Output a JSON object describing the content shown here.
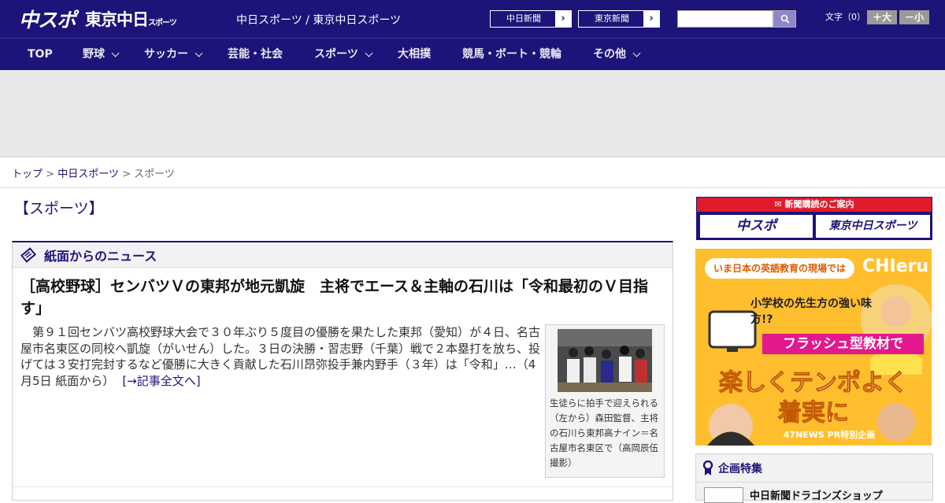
{
  "header": {
    "logo_primary": "中スポ",
    "logo_secondary": "東京中日",
    "logo_secondary_small": "スポーツ",
    "site_links": "中日スポーツ / 東京中日スポーツ",
    "paper_buttons": [
      {
        "label": "中日新聞"
      },
      {
        "label": "東京新聞"
      }
    ],
    "search": {
      "value": ""
    },
    "font_size_label": "文字（0）",
    "font_larger_label": "＋大",
    "font_smaller_label": "－小"
  },
  "nav": {
    "items": [
      {
        "label": "TOP",
        "has_dropdown": false
      },
      {
        "label": "野球",
        "has_dropdown": true
      },
      {
        "label": "サッカー",
        "has_dropdown": true
      },
      {
        "label": "芸能・社会",
        "has_dropdown": false
      },
      {
        "label": "スポーツ",
        "has_dropdown": true
      },
      {
        "label": "大相撲",
        "has_dropdown": false
      },
      {
        "label": "競馬・ボート・競輪",
        "has_dropdown": false
      },
      {
        "label": "その他",
        "has_dropdown": true
      }
    ]
  },
  "breadcrumb": {
    "items": [
      {
        "label": "トップ",
        "link": true
      },
      {
        "label": "中日スポーツ",
        "link": true
      },
      {
        "label": "スポーツ",
        "link": false
      }
    ],
    "separator": ">"
  },
  "section": {
    "title": "【スポーツ】"
  },
  "news_box": {
    "header": "紙面からのニュース",
    "headline": "［高校野球］センバツＶの東邦が地元凱旋　主将でエース＆主軸の石川は「令和最初のＶ目指す」",
    "body": "　第９１回センバツ高校野球大会で３０年ぶり５度目の優勝を果たした東邦（愛知）が４日、名古屋市名東区の同校へ凱旋（がいせん）した。３日の決勝・習志野（千葉）戦で２本塁打を放ち、投げては３安打完封するなど優勝に大きく貢献した石川昂弥投手兼内野手（３年）は「令和」…（4月5日 紙面から）",
    "more_link": "[→記事全文へ]",
    "photo_caption": "生徒らに拍手で迎えられる（左から）森田監督、主将の石川ら東邦高ナイン＝名古屋市名東区で（高岡辰伍撮影）"
  },
  "sidebar": {
    "subscribe_header": "新聞購読のご案内",
    "subscribe_buttons": [
      {
        "label": "中スポ"
      },
      {
        "label": "東京中日スポーツ"
      }
    ],
    "ad": {
      "tag": "いま日本の英語教育の現場では",
      "brand": "CHIeru",
      "lead": "小学校の先生方の強い味方!?",
      "highlight": "フラッシュ型教材で",
      "headline1": "楽しくテンポよく",
      "headline2": "着実に",
      "footer": "47NEWS PR特別企画"
    },
    "feature": {
      "header": "企画特集",
      "item": "中日新聞ドラゴンズショップ"
    }
  },
  "colors": {
    "brand_navy": "#1c1478",
    "subscribe_red": "#e01b2b",
    "ad_yellow": "#ffbe2e"
  }
}
